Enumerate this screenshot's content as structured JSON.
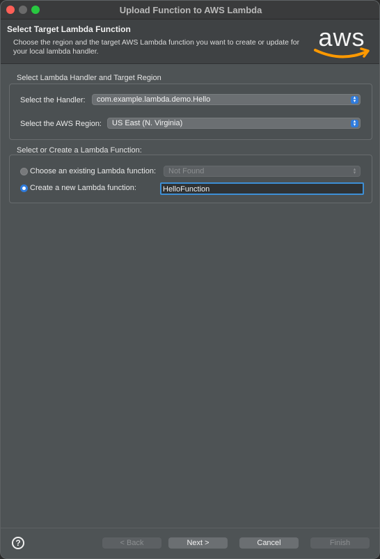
{
  "window": {
    "title": "Upload Function to AWS Lambda"
  },
  "header": {
    "title": "Select Target Lambda Function",
    "description": "Choose the region and the target AWS Lambda function you want to create or update for your local lambda handler.",
    "logo_text": "aws",
    "logo_color": "#ff9900"
  },
  "handler_group": {
    "label": "Select Lambda Handler and Target Region",
    "handler_label": "Select the Handler:",
    "handler_value": "com.example.lambda.demo.Hello",
    "region_label": "Select the AWS Region:",
    "region_value": "US East (N. Virginia)"
  },
  "function_group": {
    "label": "Select or Create a Lambda Function:",
    "existing_label": "Choose an existing Lambda function:",
    "existing_value": "Not Found",
    "existing_selected": false,
    "new_label": "Create a new Lambda function:",
    "new_selected": true,
    "new_value": "HelloFunction"
  },
  "footer": {
    "back_label": "< Back",
    "next_label": "Next >",
    "cancel_label": "Cancel",
    "finish_label": "Finish",
    "help_icon": "?"
  },
  "colors": {
    "accent": "#2f7bdc",
    "focus_ring": "#3d8fd6"
  }
}
